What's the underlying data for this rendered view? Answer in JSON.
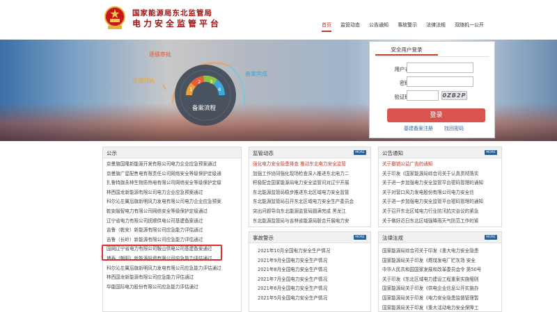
{
  "header": {
    "title_line1": "国家能源局东北监管局",
    "title_line2": "电力安全监管平台"
  },
  "nav": [
    "首页",
    "监管动态",
    "公告通知",
    "事故警示",
    "法律法规",
    "双随机一公开"
  ],
  "banner": {
    "labels": {
      "approve": "逐级审批",
      "feedback": "反馈回执",
      "submit": "备案完成",
      "flow": "备案流程",
      "step1": "1",
      "step2": "2",
      "step3": "3",
      "step4": "4"
    }
  },
  "login": {
    "tab": "安全用户登录",
    "username_label": "用户名",
    "password_label": "密码",
    "captcha_label": "验证码",
    "captcha_text": "0ZB2P",
    "submit": "登录",
    "register": "基建备案注册",
    "forgot": "找回密码"
  },
  "more_label": "MORE",
  "gongshi": {
    "title": "公示",
    "items": [
      "京曼旗国隆新能源开发有限公司电力企业应急预案通过",
      "京曼旗广星配售电有限责任公司网络安全等级保护定级通",
      "扎鲁特旗永林生物质热电有限公司网络安全等级保护定级",
      "林西国龙新能源有限公司电力企业应急预案通过",
      "科尔沁左翼后旗新明风力发电有限公司电力企业应急预案",
      "乾安融智电力有限公司网络安全等级保护定级通过",
      "辽宁省电力有限公司抚顺供电公司基建备案通过",
      "吉鲁（乾安）新能源有限公司应急能力评估通过",
      "吉鲁（长岭）新能源有限公司应急能力评估通过",
      "国网辽宁省电力有限公司鞍山供电公司基建备案通过",
      "埔泰（朝阳）新能源投资有限公司应急能力评估通过",
      "科尔沁左翼后旗新明风力发电有限公司应急能力评估通过",
      "林西国龙新能源有限公司应急能力评估通过",
      "华能国际电力股份有限公司应急能力评估通过"
    ]
  },
  "jianguan": {
    "title": "监管动态",
    "items": [
      "强化电力安全隐患排查 推动东北电力安全监管",
      "加强工作协同强化现场检查深入推进东北电力二",
      "积极配合国家能源局电力安全监管司对辽宁开展",
      "东北能源监管局稳步推进东北区域电力安全监管",
      "东北能源监管局召开东北区域电力安全生产委员会",
      "突出问题导向东北能源监管局圆满完成 黑龙江",
      "东北能源监管局与吉林省能源局联合开展电力安"
    ]
  },
  "gonggao": {
    "title": "公告通知",
    "items": [
      "关于撤销公益广告的通知",
      "关于印发《国家能源局综合司关于认真贯彻落实",
      "关于进一步加强电力安全监管平台密码管理的通知",
      "关于对营口风力发电股份有限公司电力安全信",
      "关于进一步加强电力安全监管平台密码管理的通知",
      "关于召开东北区域电力行业防汛抗灾会议的紧急",
      "关于做好近日东北区域强降雨天气防范工作的紧"
    ]
  },
  "shigu": {
    "title": "事故警示",
    "items": [
      "2021年10月全国电力安全生产情况",
      "2021年9月全国电力安全生产情况",
      "2021年8月全国电力安全生产情况",
      "2021年7月全国电力安全生产情况",
      "2021年6月全国电力安全生产情况",
      "2021年5月全国电力安全生产情况"
    ]
  },
  "falv": {
    "title": "法律法规",
    "items": [
      "国家能源局综合司关于印发《重大电力安全隐患",
      "国家能源局关于印发《燃煤发电厂贮灰场 安全",
      "中华人民共和国国家发展和改革委员会令 第50号",
      "关于印发《东北区域电力建设工程重案实施细则",
      "国家能源局关于印发《供电企业信息公开实施办",
      "国家能源局关于印发《电力安全隐患监督管理暂",
      "国家能源局关于印发《重大活动电力安全保障工"
    ]
  }
}
